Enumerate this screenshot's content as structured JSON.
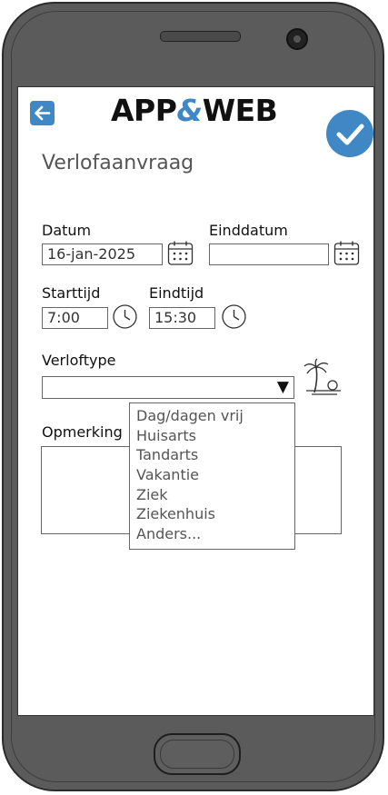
{
  "app": {
    "logo_text_left": "APP",
    "logo_amp": "&",
    "logo_text_right": "WEB"
  },
  "header": {
    "back_icon": "arrow-left-icon",
    "confirm_icon": "checkmark-icon"
  },
  "page": {
    "title": "Verlofaanvraag"
  },
  "form": {
    "datum_label": "Datum",
    "datum_value": "16-jan-2025",
    "einddatum_label": "Einddatum",
    "einddatum_value": "",
    "starttijd_label": "Starttijd",
    "starttijd_value": "7:00",
    "eindtijd_label": "Eindtijd",
    "eindtijd_value": "15:30",
    "verloftype_label": "Verloftype",
    "verloftype_value": "",
    "opmerkingen_label": "Opmerking",
    "opmerkingen_value": ""
  },
  "dropdown": {
    "options": [
      "Dag/dagen vrij",
      "Huisarts",
      "Tandarts",
      "Vakantie",
      "Ziek",
      "Ziekenhuis",
      "Anders..."
    ]
  },
  "colors": {
    "accent": "#3f88c5",
    "frame": "#5b5b5b"
  }
}
